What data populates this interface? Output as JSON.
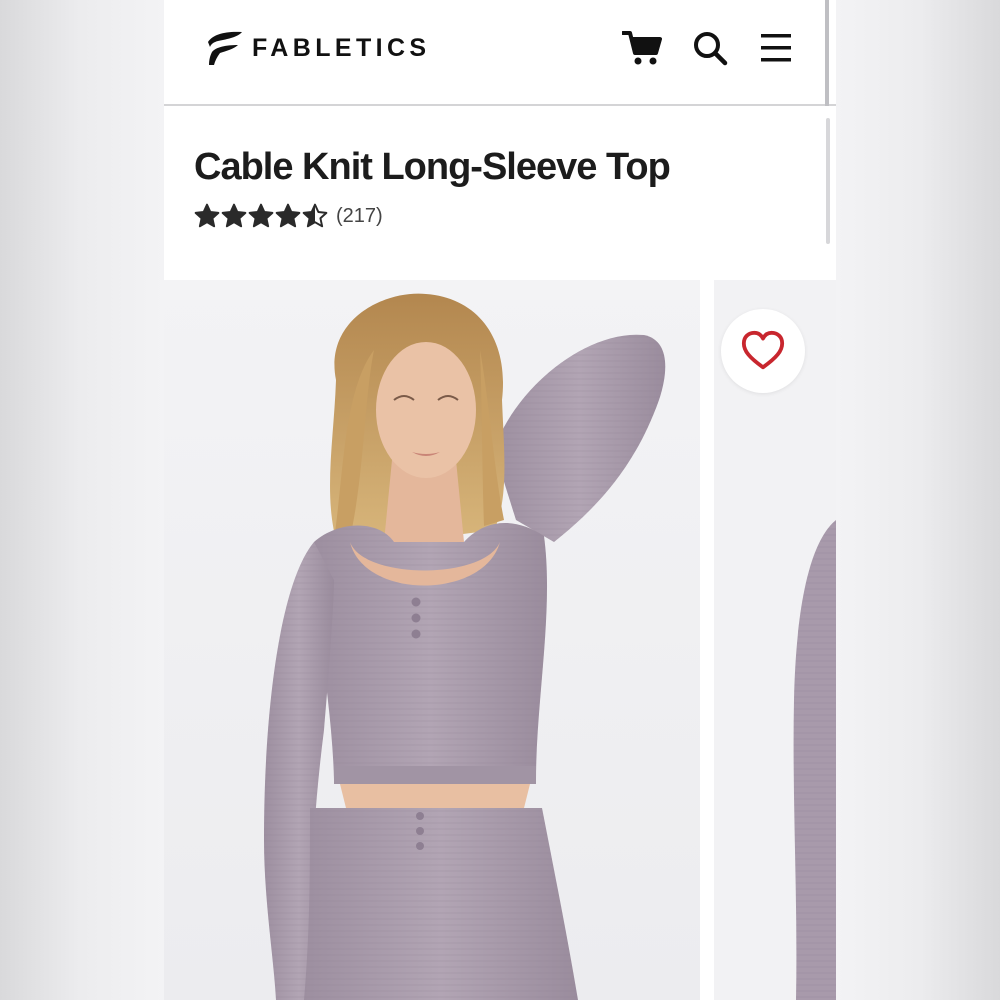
{
  "header": {
    "brand": "FABLETICS",
    "icons": {
      "cart": "cart-icon",
      "search": "search-icon",
      "menu": "hamburger-menu-icon"
    }
  },
  "product": {
    "title": "Cable Knit Long-Sleeve Top",
    "rating": 4.5,
    "rating_max": 5,
    "review_count": "(217)"
  },
  "gallery": {
    "favorite_icon": "heart-outline-icon",
    "favorite_color": "#c8262e"
  },
  "colors": {
    "text": "#1c1c1c",
    "star": "#2a2a2a",
    "garment": "#a89aab"
  }
}
